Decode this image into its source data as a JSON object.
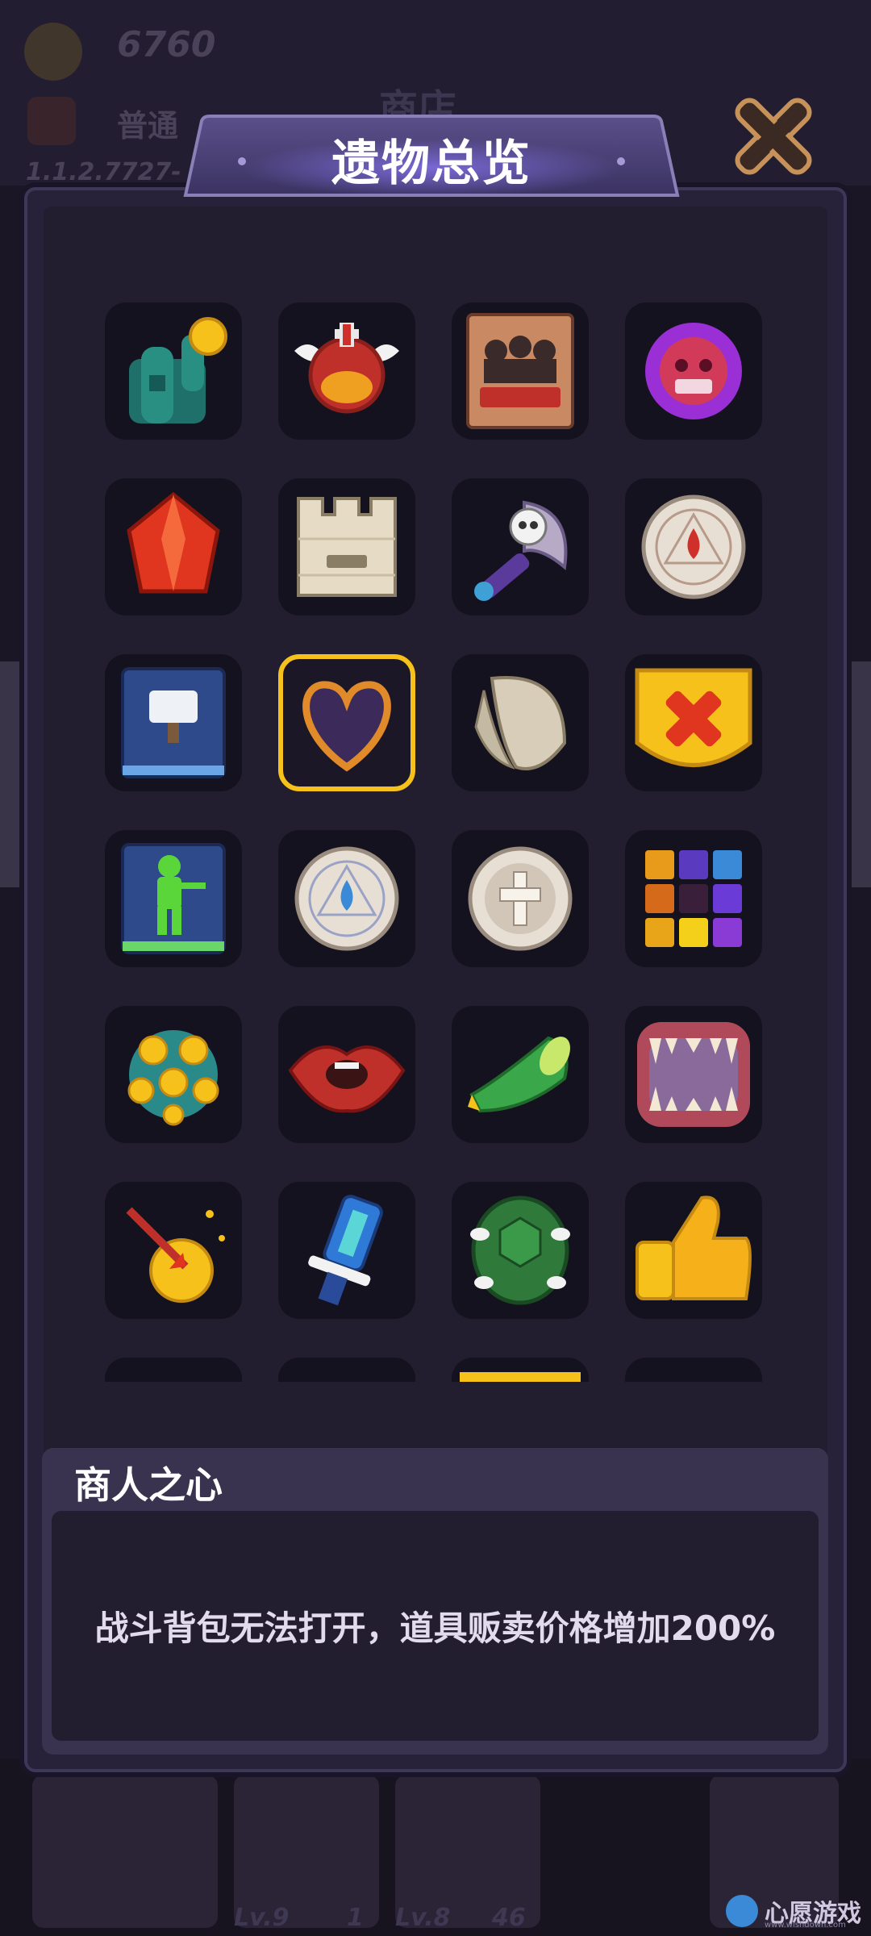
{
  "background": {
    "coins": "6760",
    "rank": "普通",
    "version": "1.1.2.7727-",
    "shop_title": "商店",
    "levels": [
      "Lv.9",
      "1",
      "Lv.8",
      "46"
    ]
  },
  "dialog": {
    "title": "遗物总览",
    "close_icon": "close-x-icon"
  },
  "relics": [
    {
      "name": "cactus-coin-relic"
    },
    {
      "name": "winged-potion-relic"
    },
    {
      "name": "sos-book-relic"
    },
    {
      "name": "purple-skull-relic"
    },
    {
      "name": "red-crystal-relic"
    },
    {
      "name": "stone-tower-relic"
    },
    {
      "name": "skull-axe-relic"
    },
    {
      "name": "blood-rune-disc-relic"
    },
    {
      "name": "hammer-book-relic"
    },
    {
      "name": "merchant-heart-relic",
      "selected": true
    },
    {
      "name": "angel-wing-relic"
    },
    {
      "name": "red-cross-shield-relic"
    },
    {
      "name": "soldier-book-relic"
    },
    {
      "name": "water-rune-disc-relic"
    },
    {
      "name": "cross-rune-disc-relic"
    },
    {
      "name": "color-blocks-relic"
    },
    {
      "name": "yellow-spore-ball-relic"
    },
    {
      "name": "red-lips-relic"
    },
    {
      "name": "green-horn-relic"
    },
    {
      "name": "fang-mouth-relic"
    },
    {
      "name": "golden-arrow-relic"
    },
    {
      "name": "blue-crystal-sword-relic"
    },
    {
      "name": "turtle-shell-relic"
    },
    {
      "name": "thumbs-up-relic"
    }
  ],
  "selected_relic": {
    "name": "商人之心",
    "description": "战斗背包无法打开，道具贩卖价格增加200%"
  },
  "watermark": {
    "text": "心愿游戏",
    "url": "www.wishdown.com"
  }
}
